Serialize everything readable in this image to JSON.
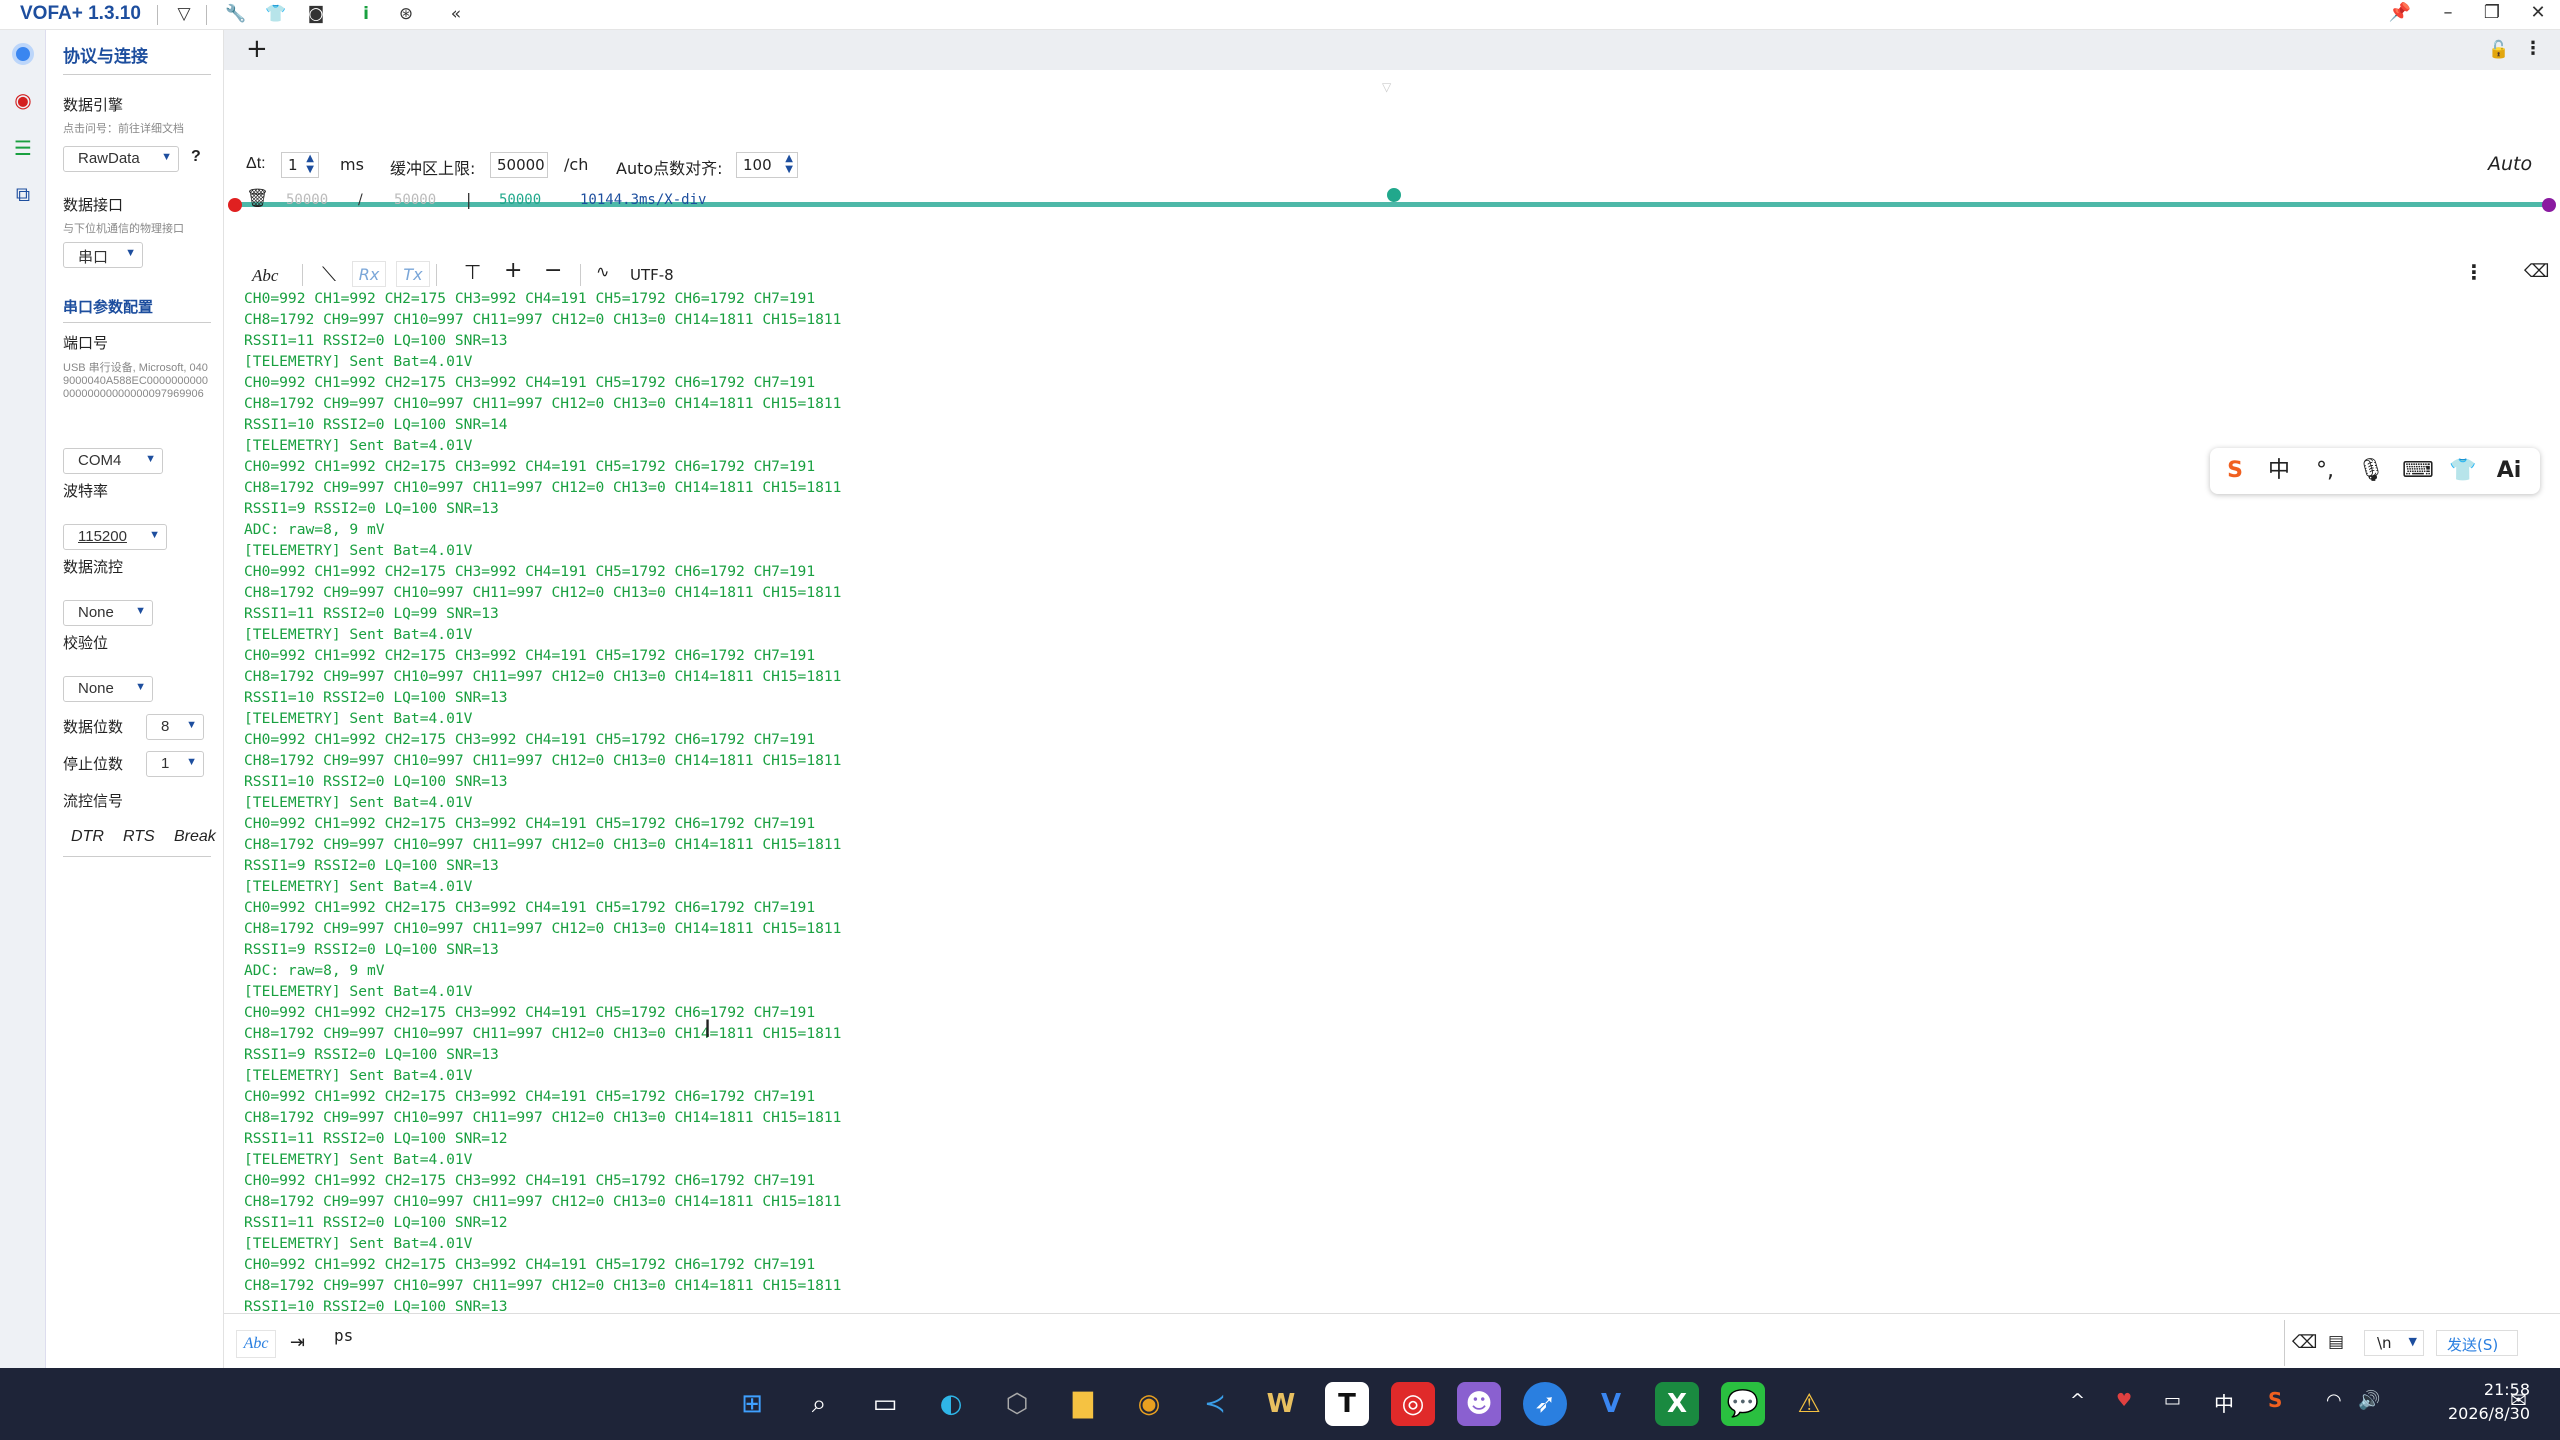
{
  "app": {
    "title": "VOFA+ 1.3.10"
  },
  "titlebar": {
    "icons": [
      "vofa-logo-icon",
      "wrench-icon",
      "shirt-icon",
      "capture-icon",
      "info-icon",
      "fingerprint-icon",
      "collapse-icon"
    ],
    "window_buttons": [
      "pin-icon",
      "minimize-icon",
      "restore-icon",
      "close-icon"
    ]
  },
  "panel": {
    "title": "协议与连接",
    "engine_label": "数据引擎",
    "engine_hint": "点击问号：前往详细文档",
    "engine_value": "RawData",
    "engine_help": "?",
    "interface_label": "数据接口",
    "interface_hint": "与下位机通信的物理接口",
    "interface_value": "串口",
    "serial_title": "串口参数配置",
    "port_label": "端口号",
    "port_desc": "USB 串行设备, Microsoft, 0409000040A588EC000000000000000000000000097969906",
    "port_value": "COM4",
    "baud_label": "波特率",
    "baud_value": "115200",
    "flow_label": "数据流控",
    "flow_value": "None",
    "parity_label": "校验位",
    "parity_value": "None",
    "databits_label": "数据位数",
    "databits_value": "8",
    "stopbits_label": "停止位数",
    "stopbits_value": "1",
    "signal_label": "流控信号",
    "dtr": "DTR",
    "rts": "RTS",
    "brk": "Break"
  },
  "tabbar": {
    "add": "+"
  },
  "settings": {
    "dt_label": "Δt:",
    "dt_value": "1",
    "dt_unit": "ms",
    "buf_label": "缓冲区上限:",
    "buf_value": "50000",
    "buf_unit": "/ch",
    "auto_label": "Auto点数对齐:",
    "auto_value": "100",
    "auto_mode": "Auto"
  },
  "range": {
    "a": "50000",
    "sep1": "/",
    "b": "50000",
    "sep2": "|",
    "c": "50000",
    "xdiv": "10144.3ms/X-div",
    "slider_level": 0.5
  },
  "toolbar": {
    "abc": "Abc",
    "rx": "Rx",
    "tx": "Tx",
    "encoding": "UTF-8"
  },
  "terminal_lines": [
    "CH0=992 CH1=992 CH2=175 CH3=992 CH4=191 CH5=1792 CH6=1792 CH7=191",
    "CH8=1792 CH9=997 CH10=997 CH11=997 CH12=0 CH13=0 CH14=1811 CH15=1811",
    "RSSI1=11 RSSI2=0 LQ=100 SNR=13",
    "[TELEMETRY] Sent Bat=4.01V",
    "CH0=992 CH1=992 CH2=175 CH3=992 CH4=191 CH5=1792 CH6=1792 CH7=191",
    "CH8=1792 CH9=997 CH10=997 CH11=997 CH12=0 CH13=0 CH14=1811 CH15=1811",
    "RSSI1=10 RSSI2=0 LQ=100 SNR=14",
    "[TELEMETRY] Sent Bat=4.01V",
    "CH0=992 CH1=992 CH2=175 CH3=992 CH4=191 CH5=1792 CH6=1792 CH7=191",
    "CH8=1792 CH9=997 CH10=997 CH11=997 CH12=0 CH13=0 CH14=1811 CH15=1811",
    "RSSI1=9 RSSI2=0 LQ=100 SNR=13",
    "ADC: raw=8, 9 mV",
    "[TELEMETRY] Sent Bat=4.01V",
    "CH0=992 CH1=992 CH2=175 CH3=992 CH4=191 CH5=1792 CH6=1792 CH7=191",
    "CH8=1792 CH9=997 CH10=997 CH11=997 CH12=0 CH13=0 CH14=1811 CH15=1811",
    "RSSI1=11 RSSI2=0 LQ=99 SNR=13",
    "[TELEMETRY] Sent Bat=4.01V",
    "CH0=992 CH1=992 CH2=175 CH3=992 CH4=191 CH5=1792 CH6=1792 CH7=191",
    "CH8=1792 CH9=997 CH10=997 CH11=997 CH12=0 CH13=0 CH14=1811 CH15=1811",
    "RSSI1=10 RSSI2=0 LQ=100 SNR=13",
    "[TELEMETRY] Sent Bat=4.01V",
    "CH0=992 CH1=992 CH2=175 CH3=992 CH4=191 CH5=1792 CH6=1792 CH7=191",
    "CH8=1792 CH9=997 CH10=997 CH11=997 CH12=0 CH13=0 CH14=1811 CH15=1811",
    "RSSI1=10 RSSI2=0 LQ=100 SNR=13",
    "[TELEMETRY] Sent Bat=4.01V",
    "CH0=992 CH1=992 CH2=175 CH3=992 CH4=191 CH5=1792 CH6=1792 CH7=191",
    "CH8=1792 CH9=997 CH10=997 CH11=997 CH12=0 CH13=0 CH14=1811 CH15=1811",
    "RSSI1=9 RSSI2=0 LQ=100 SNR=13",
    "[TELEMETRY] Sent Bat=4.01V",
    "CH0=992 CH1=992 CH2=175 CH3=992 CH4=191 CH5=1792 CH6=1792 CH7=191",
    "CH8=1792 CH9=997 CH10=997 CH11=997 CH12=0 CH13=0 CH14=1811 CH15=1811",
    "RSSI1=9 RSSI2=0 LQ=100 SNR=13",
    "ADC: raw=8, 9 mV",
    "[TELEMETRY] Sent Bat=4.01V",
    "CH0=992 CH1=992 CH2=175 CH3=992 CH4=191 CH5=1792 CH6=1792 CH7=191",
    "CH8=1792 CH9=997 CH10=997 CH11=997 CH12=0 CH13=0 CH14=1811 CH15=1811",
    "RSSI1=9 RSSI2=0 LQ=100 SNR=13",
    "[TELEMETRY] Sent Bat=4.01V",
    "CH0=992 CH1=992 CH2=175 CH3=992 CH4=191 CH5=1792 CH6=1792 CH7=191",
    "CH8=1792 CH9=997 CH10=997 CH11=997 CH12=0 CH13=0 CH14=1811 CH15=1811",
    "RSSI1=11 RSSI2=0 LQ=100 SNR=12",
    "[TELEMETRY] Sent Bat=4.01V",
    "CH0=992 CH1=992 CH2=175 CH3=992 CH4=191 CH5=1792 CH6=1792 CH7=191",
    "CH8=1792 CH9=997 CH10=997 CH11=997 CH12=0 CH13=0 CH14=1811 CH15=1811",
    "RSSI1=11 RSSI2=0 LQ=100 SNR=12",
    "[TELEMETRY] Sent Bat=4.01V",
    "CH0=992 CH1=992 CH2=175 CH3=992 CH4=191 CH5=1792 CH6=1792 CH7=191",
    "CH8=1792 CH9=997 CH10=997 CH11=997 CH12=0 CH13=0 CH14=1811 CH15=1811",
    "RSSI1=10 RSSI2=0 LQ=100 SNR=13"
  ],
  "send": {
    "abc": "Abc",
    "input_value": "ps",
    "newline": "\\n",
    "send_label": "发送(S)"
  },
  "taskbar": {
    "apps": [
      "windows-start-icon",
      "search-icon",
      "task-view-icon",
      "edge-icon",
      "widgets-icon",
      "file-explorer-icon",
      "chrome-icon",
      "vscode-icon",
      "wps-icon",
      "typora-icon",
      "netease-music-icon",
      "cat-app-icon",
      "feishu-icon",
      "vofa-icon",
      "excel-icon",
      "wechat-icon",
      "warning-icon"
    ],
    "tray": {
      "ime": "中",
      "time": "21:58",
      "date": "2026/8/30"
    }
  },
  "ime_toolbar": {
    "ime_char": "中"
  },
  "colors": {
    "accent": "#1d4e9e",
    "terminal_text": "#19a040",
    "slider_track": "#4db8a8",
    "taskbar": "#1e2438"
  }
}
